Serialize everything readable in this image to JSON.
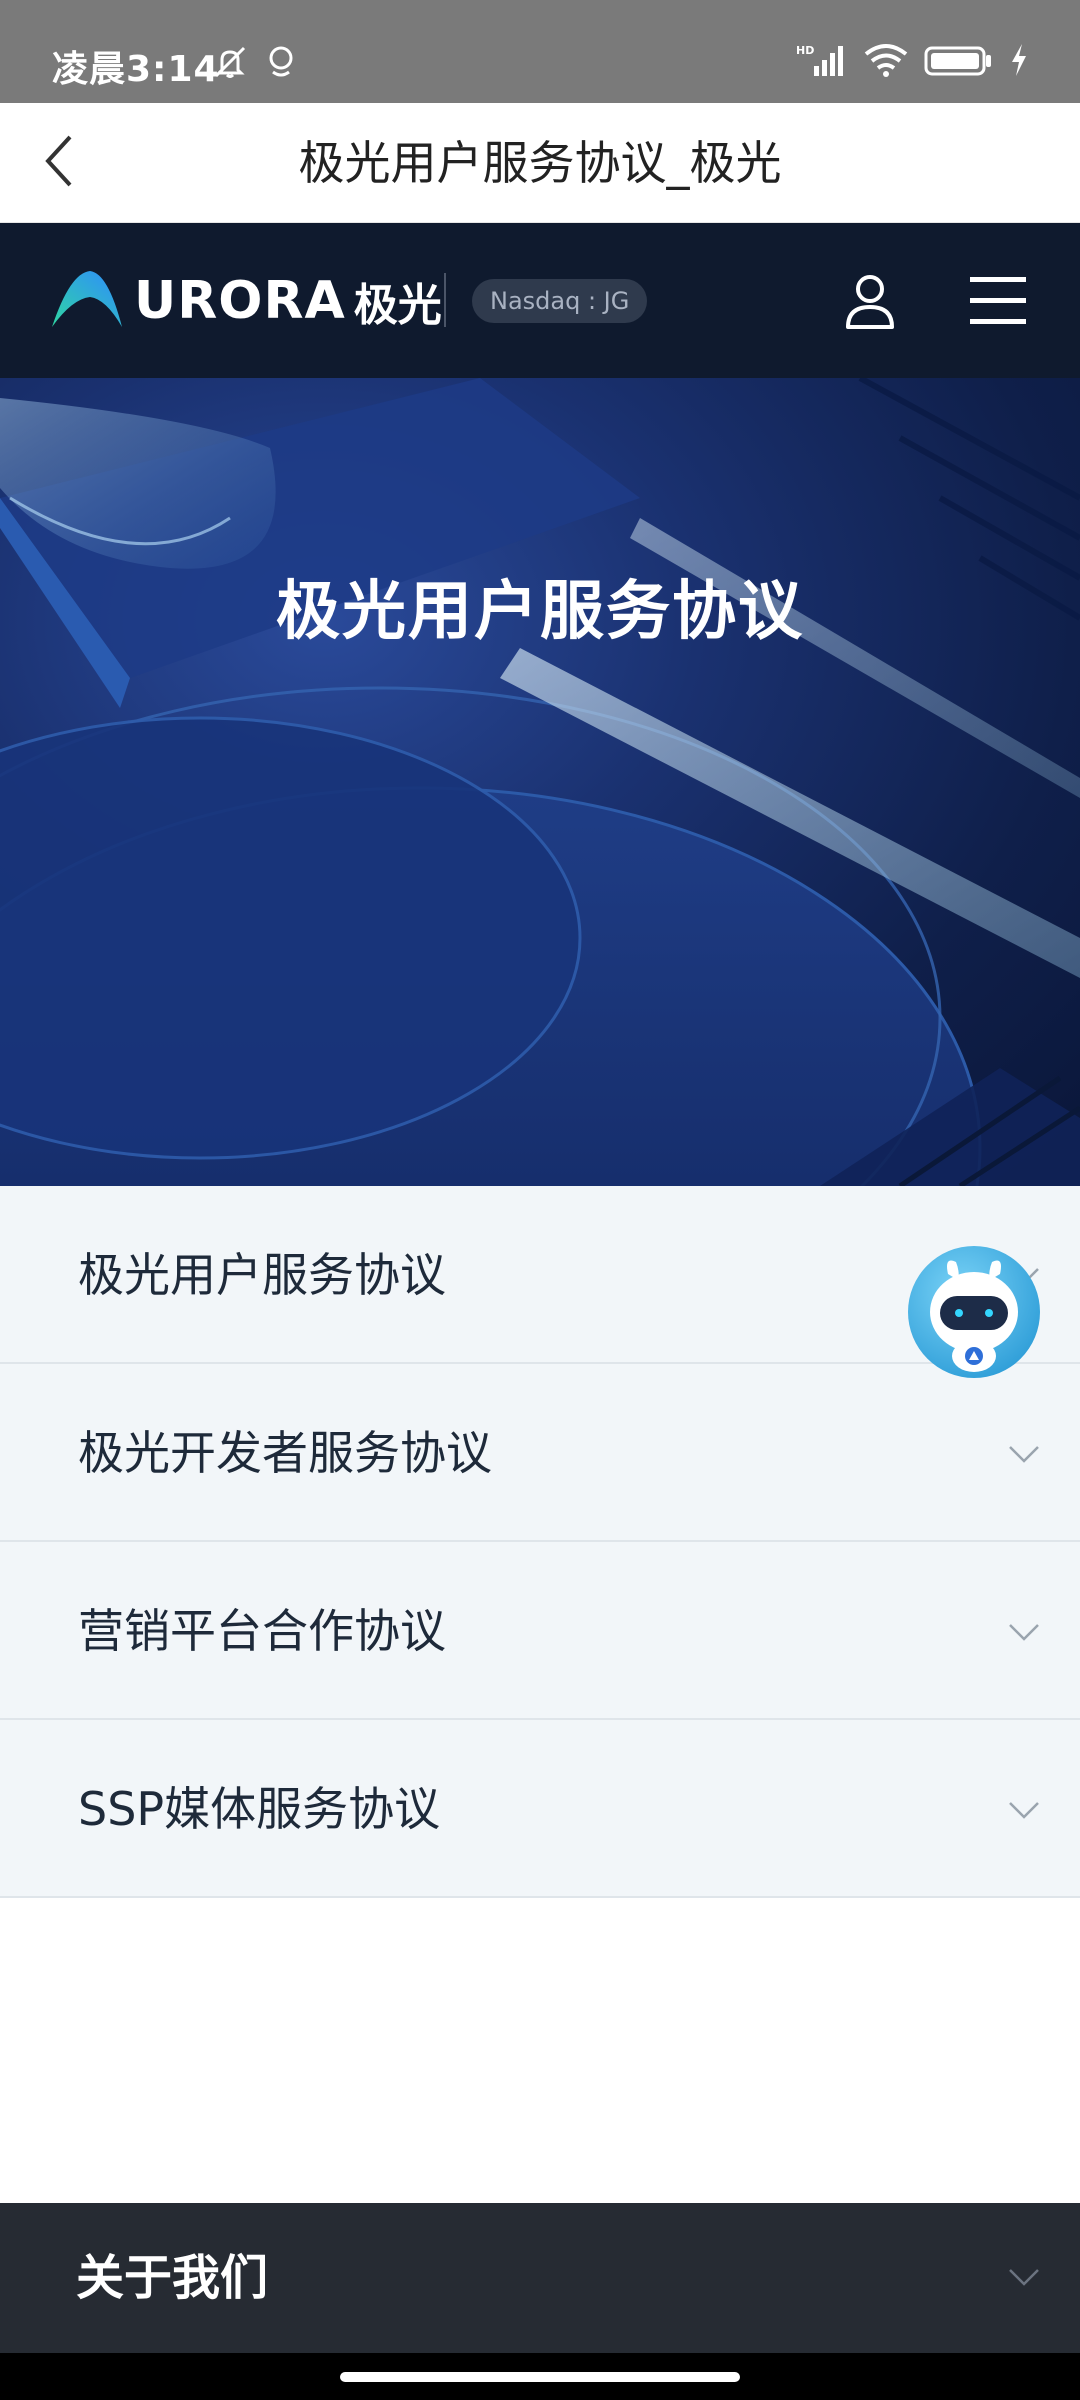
{
  "status_bar": {
    "time": "凌晨3:14",
    "icons": [
      "mute-icon",
      "location-icon",
      "signal-icon",
      "wifi-icon",
      "battery-icon",
      "charging-icon"
    ]
  },
  "title_bar": {
    "title": "极光用户服务协议_极光",
    "back_icon": "chevron-left-icon"
  },
  "site_nav": {
    "logo_text": "URORA",
    "logo_cn": "极光",
    "badge": "Nasdaq : JG",
    "user_icon": "user-icon",
    "menu_icon": "hamburger-menu-icon"
  },
  "hero": {
    "title": "极光用户服务协议"
  },
  "agreements": [
    {
      "label": "极光用户服务协议"
    },
    {
      "label": "极光开发者服务协议"
    },
    {
      "label": "营销平台合作协议"
    },
    {
      "label": "SSP媒体服务协议"
    }
  ],
  "footer": {
    "about_label": "关于我们"
  },
  "colors": {
    "status_bar": "#7a7a7a",
    "nav_bg": "#0f1a2e",
    "hero_bg": "#1a3170",
    "list_bg": "#f2f6f9",
    "footer_bg": "#262b33",
    "logo_accent_green": "#2fd6a3",
    "logo_accent_blue": "#2f8bff"
  }
}
